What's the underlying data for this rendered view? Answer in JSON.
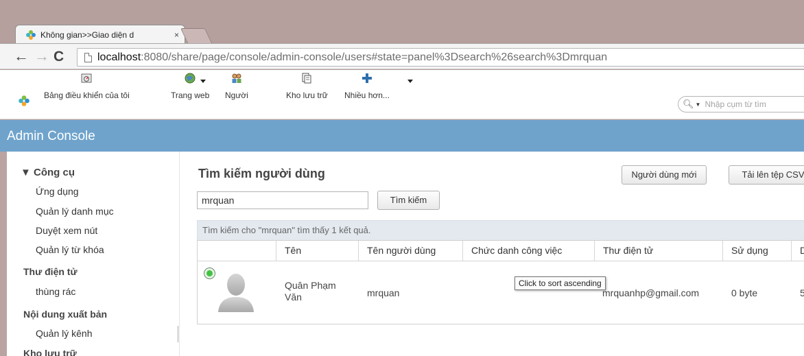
{
  "browser": {
    "tab_title": "Không gian>>Giao diện d",
    "tab_close": "×",
    "url_scheme_host": "localhost",
    "url_rest": ":8080/share/page/console/admin-console/users#state=panel%3Dsearch%26search%3Dmrquan"
  },
  "header": {
    "nav": [
      {
        "label": "Bảng điều khiển của tôi"
      },
      {
        "label": "Trang web"
      },
      {
        "label": "Người"
      },
      {
        "label": "Kho lưu trữ"
      },
      {
        "label": "Nhiều hơn..."
      }
    ],
    "search_placeholder": "Nhập cụm từ tìm"
  },
  "console": {
    "title": "Admin Console"
  },
  "sidebar": {
    "tools_title": "▼ Công cụ",
    "tools": [
      "Ứng dụng",
      "Quản lý danh mục",
      "Duyệt xem nút",
      "Quản lý từ khóa"
    ],
    "email_title": "Thư điện tử",
    "email_items": [
      "thùng rác"
    ],
    "publish_title": "Nội dung xuất bản",
    "publish_items": [
      "Quản lý kênh"
    ],
    "repo_title": "Kho lưu trữ"
  },
  "main": {
    "title": "Tìm kiếm người dùng",
    "new_user_button": "Người dùng mới",
    "upload_button": "Tải lên tệp CSV",
    "search_value": "mrquan",
    "search_button": "Tìm kiếm",
    "results_text": "Tìm kiếm cho \"mrquan\" tìm thấy 1 kết quả.",
    "columns": [
      "Tên",
      "Tên người dùng",
      "Chức danh công việc",
      "Thư điện tử",
      "Sử dụng",
      "D"
    ],
    "rows": [
      {
        "name_line1": "Quân Phạm",
        "name_line2": "Văn",
        "username": "mrquan",
        "job_title": "",
        "email": "mrquanhp@gmail.com",
        "usage": "0 byte",
        "extra": "5"
      }
    ],
    "tooltip": "Click to sort ascending"
  },
  "colors": {
    "console_bar": "#6fa3cc",
    "results_bar": "#e3e9ef",
    "status_green": "#42c242"
  },
  "icons": [
    "alfresco-logo-icon",
    "dashboard-icon",
    "globe-icon",
    "people-icon",
    "repository-icon",
    "plus-icon",
    "magnifier-icon",
    "avatar-placeholder-icon"
  ]
}
